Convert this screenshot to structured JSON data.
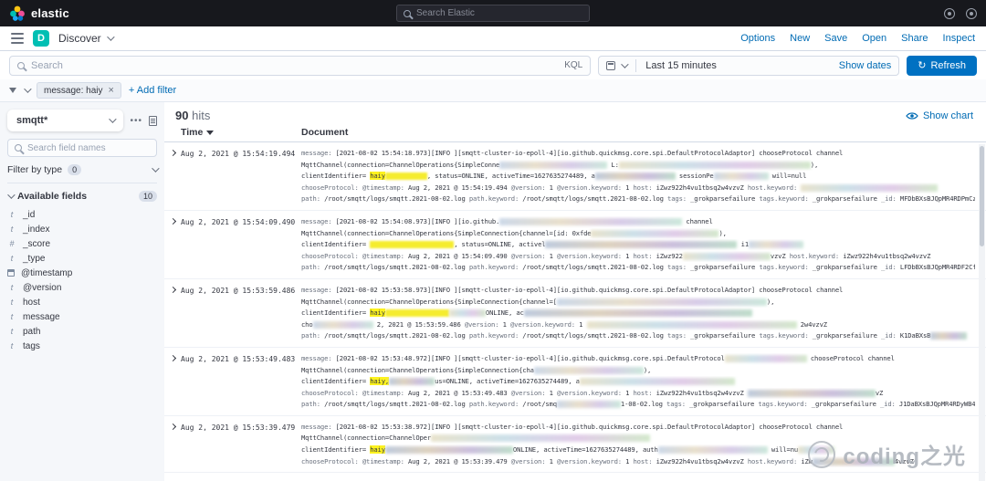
{
  "header": {
    "brand": "elastic",
    "search_placeholder": "Search Elastic"
  },
  "nav": {
    "app_letter": "D",
    "app_name": "Discover",
    "links": [
      "Options",
      "New",
      "Save",
      "Open",
      "Share",
      "Inspect"
    ]
  },
  "query_bar": {
    "search_placeholder": "Search",
    "language": "KQL",
    "time_range": "Last 15 minutes",
    "show_dates": "Show dates",
    "refresh_label": "Refresh",
    "refresh_icon": "↻"
  },
  "filter_bar": {
    "filter_pill": "message: haiy",
    "remove_icon": "×",
    "add_filter": "+ Add filter"
  },
  "sidebar": {
    "index_pattern": "smqtt*",
    "options_icon": "•••",
    "field_search_placeholder": "Search field names",
    "filter_by_type_label": "Filter by type",
    "filter_by_type_count": "0",
    "available_fields_label": "Available fields",
    "available_fields_count": "10",
    "fields": [
      {
        "name": "_id",
        "type": "t"
      },
      {
        "name": "_index",
        "type": "t"
      },
      {
        "name": "_score",
        "type": "#"
      },
      {
        "name": "_type",
        "type": "t"
      },
      {
        "name": "@timestamp",
        "type": "cal"
      },
      {
        "name": "@version",
        "type": "t"
      },
      {
        "name": "host",
        "type": "t"
      },
      {
        "name": "message",
        "type": "t"
      },
      {
        "name": "path",
        "type": "t"
      },
      {
        "name": "tags",
        "type": "t"
      }
    ]
  },
  "results": {
    "hits_value": "90",
    "hits_label": "hits",
    "show_chart": "Show chart",
    "columns": {
      "time": "Time",
      "document": "Document"
    },
    "rows": [
      {
        "time": "Aug 2, 2021 @ 15:54:19.494",
        "lines": [
          [
            [
              "f",
              "message:"
            ],
            [
              "v",
              " [2021-08-02 15:54:18.973][INFO ][smqtt-cluster-io-epoll-4][io.github.quickmsg.core.spi.DefaultProtocolAdaptor] chooseProtocol channel"
            ]
          ],
          [
            [
              "v",
              "MqttChannel(connection=ChannelOperations{SimpleConne"
            ],
            [
              "r",
              118,
              0
            ],
            [
              "v",
              "  L:"
            ],
            [
              "r",
              210,
              1
            ],
            [
              "v",
              "),"
            ]
          ],
          [
            [
              "v",
              "clientIdentifier= "
            ],
            [
              "m",
              "haiy"
            ],
            [
              "y",
              46
            ],
            [
              "v",
              ", status=ONLINE, activeTime=1627635274489, a"
            ],
            [
              "r",
              88,
              2
            ],
            [
              "v",
              "  sessionPe"
            ],
            [
              "r",
              60,
              0
            ],
            [
              "v",
              "  will=null"
            ]
          ],
          [
            [
              "f",
              "chooseProtocol:"
            ],
            [
              "v",
              "  "
            ],
            [
              "f",
              "@timestamp:"
            ],
            [
              "v",
              " Aug 2, 2021 @ 15:54:19.494 "
            ],
            [
              "f",
              "@version:"
            ],
            [
              "v",
              " 1 "
            ],
            [
              "f",
              "@version.keyword:"
            ],
            [
              "v",
              " 1 "
            ],
            [
              "f",
              "host:"
            ],
            [
              "v",
              " iZwz922h4vu1tbsq2w4vzvZ "
            ],
            [
              "f",
              "host.keyword:"
            ],
            [
              "v",
              " "
            ],
            [
              "r",
              150,
              1
            ]
          ],
          [
            [
              "f",
              "path:"
            ],
            [
              "v",
              " /root/smqtt/logs/smqtt.2021-08-02.log "
            ],
            [
              "f",
              "path.keyword:"
            ],
            [
              "v",
              " /root/smqtt/logs/smqtt.2021-08-02.log "
            ],
            [
              "f",
              "tags:"
            ],
            [
              "v",
              " _grokparsefailure "
            ],
            [
              "f",
              "tags.keyword:"
            ],
            [
              "v",
              " _grokparsefailure "
            ],
            [
              "f",
              "_id:"
            ],
            [
              "v",
              " MFDbBXsBJQpMR4RDPmCz"
            ]
          ]
        ]
      },
      {
        "time": "Aug 2, 2021 @ 15:54:09.490",
        "lines": [
          [
            [
              "f",
              "message:"
            ],
            [
              "v",
              " [2021-08-02 15:54:08.973][INFO ][io.github."
            ],
            [
              "r",
              200,
              0
            ],
            [
              "v",
              " channel"
            ]
          ],
          [
            [
              "v",
              "MqttChannel(connection=ChannelOperations{SimpleConnection{channel=[id: 0xfde"
            ],
            [
              "r",
              140,
              1
            ],
            [
              "v",
              "),"
            ]
          ],
          [
            [
              "v",
              "clientIdentifier= "
            ],
            [
              "y",
              92
            ],
            [
              "v",
              ", status=ONLINE, activel"
            ],
            [
              "r",
              210,
              2
            ],
            [
              "v",
              " i1"
            ],
            [
              "r",
              60,
              0
            ]
          ],
          [
            [
              "f",
              "chooseProtocol:"
            ],
            [
              "v",
              "  "
            ],
            [
              "f",
              "@timestamp:"
            ],
            [
              "v",
              " Aug 2, 2021 @ 15:54:09.490 "
            ],
            [
              "f",
              "@version:"
            ],
            [
              "v",
              " 1 "
            ],
            [
              "f",
              "@version.keyword:"
            ],
            [
              "v",
              " 1 "
            ],
            [
              "f",
              "host:"
            ],
            [
              "v",
              " iZwz922"
            ],
            [
              "r",
              96,
              1
            ],
            [
              "v",
              "vzvZ "
            ],
            [
              "f",
              "host.keyword:"
            ],
            [
              "v",
              " iZwz922h4vu1tbsq2w4vzvZ"
            ]
          ],
          [
            [
              "f",
              "path:"
            ],
            [
              "v",
              " /root/smqtt/logs/smqtt.2021-08-02.log "
            ],
            [
              "f",
              "path.keyword:"
            ],
            [
              "v",
              " /root/smqtt/logs/smqtt.2021-08-02.log "
            ],
            [
              "f",
              "tags:"
            ],
            [
              "v",
              " _grokparsefailure "
            ],
            [
              "f",
              "tags.keyword:"
            ],
            [
              "v",
              " _grokparsefailure "
            ],
            [
              "f",
              "_id:"
            ],
            [
              "v",
              " LFDbBXsBJQpMR4RDF2Cf"
            ]
          ]
        ]
      },
      {
        "time": "Aug 2, 2021 @ 15:53:59.486",
        "lines": [
          [
            [
              "f",
              "message:"
            ],
            [
              "v",
              " [2021-08-02 15:53:58.973][INFO ][smqtt-cluster-io-epoll-4][io.github.quickmsg.core.spi.DefaultProtocolAdaptor] chooseProtocol channel"
            ]
          ],
          [
            [
              "v",
              "MqttChannel(connection=ChannelOperations{SimpleConnection{channel=["
            ],
            [
              "r",
              230,
              0
            ],
            [
              "v",
              "),"
            ]
          ],
          [
            [
              "v",
              "clientIdentifier= "
            ],
            [
              "m",
              "haiy"
            ],
            [
              "y",
              70
            ],
            [
              "r",
              40,
              1
            ],
            [
              "v",
              "ONLINE, ac"
            ],
            [
              "r",
              250,
              2
            ]
          ],
          [
            [
              "v",
              "cho"
            ],
            [
              "r",
              66,
              0
            ],
            [
              "v",
              " 2, 2021 @ 15:53:59.486 "
            ],
            [
              "f",
              "@version:"
            ],
            [
              "v",
              " 1 "
            ],
            [
              "f",
              "@version.keyword:"
            ],
            [
              "v",
              " 1 "
            ],
            [
              "r",
              230,
              1
            ],
            [
              "v",
              " 2w4vzvZ"
            ]
          ],
          [
            [
              "f",
              "path:"
            ],
            [
              "v",
              " /root/smqtt/logs/smqtt.2021-08-02.log "
            ],
            [
              "f",
              "path.keyword:"
            ],
            [
              "v",
              " /root/smqtt/logs/smqtt.2021-08-02.log "
            ],
            [
              "f",
              "tags:"
            ],
            [
              "v",
              " _grokparsefailure "
            ],
            [
              "f",
              "tags.keyword:"
            ],
            [
              "v",
              " _grokparsefailure "
            ],
            [
              "f",
              "_id:"
            ],
            [
              "v",
              " K1DaBXsB"
            ],
            [
              "r",
              40,
              2
            ]
          ]
        ]
      },
      {
        "time": "Aug 2, 2021 @ 15:53:49.483",
        "lines": [
          [
            [
              "f",
              "message:"
            ],
            [
              "v",
              " [2021-08-02 15:53:48.972][INFO ][smqtt-cluster-io-epoll-4][io.github.quickmsg.core.spi.DefaultProtocol"
            ],
            [
              "r",
              90,
              1
            ],
            [
              "v",
              " chooseProtocol channel"
            ]
          ],
          [
            [
              "v",
              "MqttChannel(connection=ChannelOperations{SimpleConnection{cha"
            ],
            [
              "r",
              120,
              0
            ],
            [
              "v",
              "),"
            ]
          ],
          [
            [
              "v",
              "clientIdentifier= "
            ],
            [
              "m",
              "haiy,"
            ],
            [
              "r",
              50,
              2
            ],
            [
              "v",
              "us=ONLINE, activeTime=1627635274489, a"
            ],
            [
              "r",
              170,
              1
            ]
          ],
          [
            [
              "f",
              "chooseProtocol:"
            ],
            [
              "v",
              "  "
            ],
            [
              "f",
              "@timestamp:"
            ],
            [
              "v",
              " Aug 2, 2021 @ 15:53:49.483 "
            ],
            [
              "f",
              "@version:"
            ],
            [
              "v",
              " 1 "
            ],
            [
              "f",
              "@version.keyword:"
            ],
            [
              "v",
              " 1 "
            ],
            [
              "f",
              "host:"
            ],
            [
              "v",
              " iZwz922h4vu1tbsq2w4vzvZ "
            ],
            [
              "r",
              140,
              2
            ],
            [
              "v",
              "vZ"
            ]
          ],
          [
            [
              "f",
              "path:"
            ],
            [
              "v",
              " /root/smqtt/logs/smqtt.2021-08-02.log "
            ],
            [
              "f",
              "path.keyword:"
            ],
            [
              "v",
              " /root/smq"
            ],
            [
              "r",
              70,
              0
            ],
            [
              "v",
              "1-08-02.log "
            ],
            [
              "f",
              "tags:"
            ],
            [
              "v",
              " _grokparsefailure "
            ],
            [
              "f",
              "tags.keyword:"
            ],
            [
              "v",
              " _grokparsefailure "
            ],
            [
              "f",
              "_id:"
            ],
            [
              "v",
              " J1DaBXsBJQpMR4RDyWB4"
            ]
          ]
        ]
      },
      {
        "time": "Aug 2, 2021 @ 15:53:39.479",
        "lines": [
          [
            [
              "f",
              "message:"
            ],
            [
              "v",
              " [2021-08-02 15:53:38.972][INFO ][smqtt-cluster-io-epoll-4][io.github.quickmsg.core.spi.DefaultProtocolAdaptor] chooseProtocol channel"
            ]
          ],
          [
            [
              "v",
              "MqttChannel(connection=ChannelOper"
            ],
            [
              "r",
              240,
              1
            ]
          ],
          [
            [
              "v",
              "clientIdentifier= "
            ],
            [
              "m",
              "haiy"
            ],
            [
              "r",
              140,
              2
            ],
            [
              "v",
              "ONLINE, activeTime=1627635274489, auth"
            ],
            [
              "r",
              120,
              0
            ],
            [
              "v",
              "  will=nu"
            ],
            [
              "r",
              40,
              1
            ]
          ],
          [
            [
              "f",
              "chooseProtocol:"
            ],
            [
              "v",
              "  "
            ],
            [
              "f",
              "@timestamp:"
            ],
            [
              "v",
              " Aug 2, 2021 @ 15:53:39.479 "
            ],
            [
              "f",
              "@version:"
            ],
            [
              "v",
              " 1 "
            ],
            [
              "f",
              "@version.keyword:"
            ],
            [
              "v",
              " 1 "
            ],
            [
              "f",
              "host:"
            ],
            [
              "v",
              " iZwz922h4vu1tbsq2w4vzvZ "
            ],
            [
              "f",
              "host.keyword:"
            ],
            [
              "v",
              " iZw"
            ],
            [
              "r",
              90,
              2
            ],
            [
              "v",
              "4vzvZ"
            ]
          ]
        ]
      }
    ]
  },
  "watermark": {
    "text": "coding之光"
  },
  "colors": {
    "link": "#006bb4",
    "refresh_button": "#0071c2",
    "highlight": "#fdf21e",
    "app_badge": "#00bfb3",
    "header_bg": "#17181d"
  }
}
